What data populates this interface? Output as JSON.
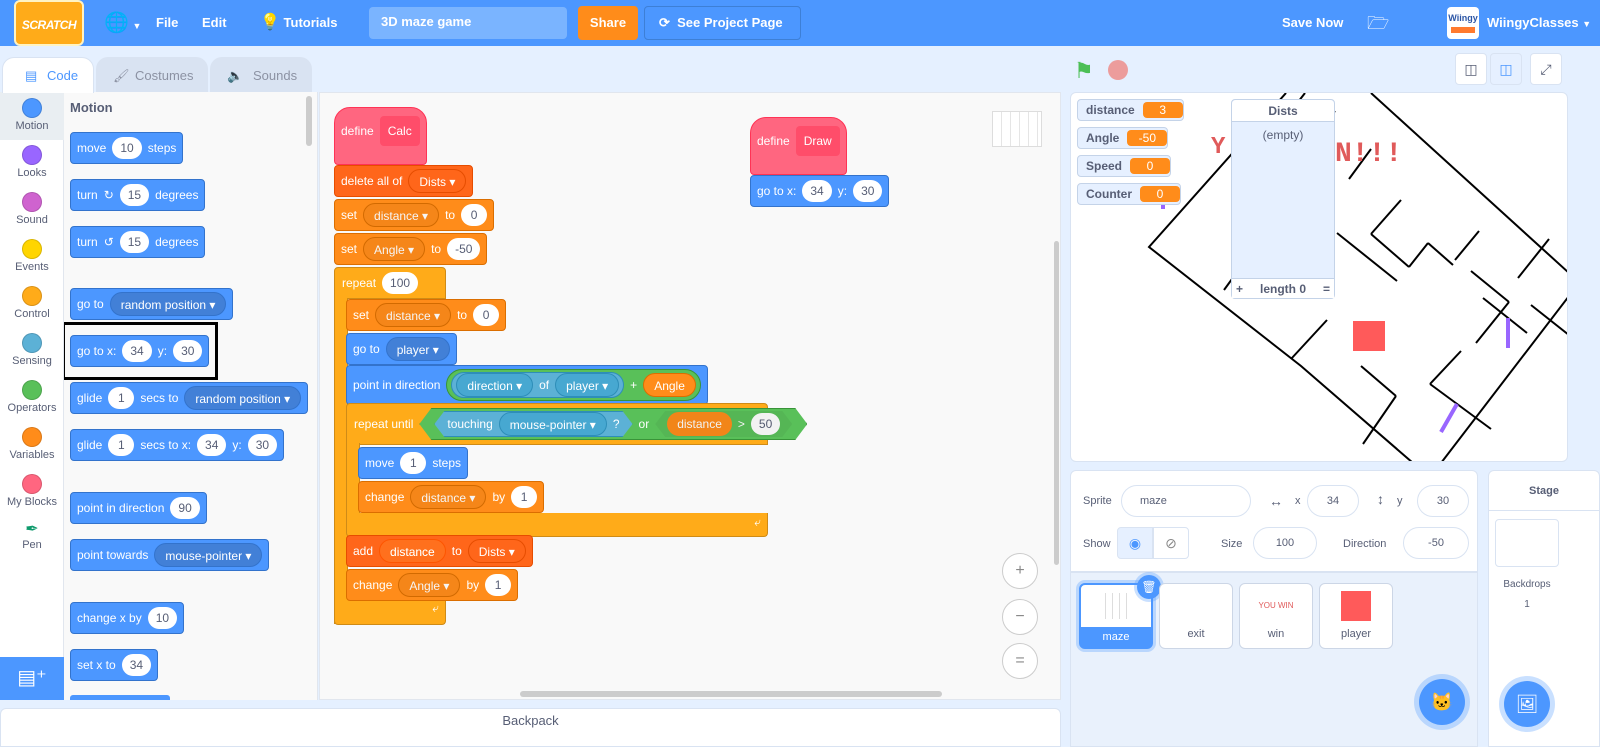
{
  "menubar": {
    "logo": "SCRATCH",
    "file": "File",
    "edit": "Edit",
    "tutorials": "Tutorials",
    "project_title": "3D maze game",
    "share": "Share",
    "see_project_page": "See Project Page",
    "save_now": "Save Now",
    "username": "WiingyClasses",
    "avatar_text": "Wiingy"
  },
  "tabs": [
    {
      "label": "Code",
      "active": true
    },
    {
      "label": "Costumes",
      "active": false
    },
    {
      "label": "Sounds",
      "active": false
    }
  ],
  "categories": [
    {
      "label": "Motion",
      "color": "#4c97ff"
    },
    {
      "label": "Looks",
      "color": "#9966ff"
    },
    {
      "label": "Sound",
      "color": "#cf63cf"
    },
    {
      "label": "Events",
      "color": "#ffd500"
    },
    {
      "label": "Control",
      "color": "#ffab19"
    },
    {
      "label": "Sensing",
      "color": "#5cb1d6"
    },
    {
      "label": "Operators",
      "color": "#59c059"
    },
    {
      "label": "Variables",
      "color": "#ff8c1a"
    },
    {
      "label": "My Blocks",
      "color": "#ff6680"
    },
    {
      "label": "Pen",
      "color": ""
    }
  ],
  "palette": {
    "heading": "Motion",
    "blocks": {
      "move": {
        "t1": "move",
        "v": "10",
        "t2": "steps"
      },
      "turn_right": {
        "t1": "turn",
        "v": "15",
        "t2": "degrees"
      },
      "turn_left": {
        "t1": "turn",
        "v": "15",
        "t2": "degrees"
      },
      "goto": {
        "t1": "go to",
        "dd": "random position"
      },
      "gotoxy": {
        "t1": "go to x:",
        "x": "34",
        "t2": "y:",
        "y": "30"
      },
      "glide_to": {
        "t1": "glide",
        "v": "1",
        "t2": "secs to",
        "dd": "random position"
      },
      "glide_xy": {
        "t1": "glide",
        "v": "1",
        "t2": "secs to x:",
        "x": "34",
        "t3": "y:",
        "y": "30"
      },
      "point_dir": {
        "t1": "point in direction",
        "v": "90"
      },
      "point_towards": {
        "t1": "point towards",
        "dd": "mouse-pointer"
      },
      "change_x": {
        "t1": "change x by",
        "v": "10"
      },
      "set_x": {
        "t1": "set x to",
        "v": "34"
      }
    }
  },
  "script_calc": {
    "define": "define",
    "name": "Calc",
    "delete_all": {
      "t1": "delete all of",
      "dd": "Dists"
    },
    "set1": {
      "t1": "set",
      "dd": "distance",
      "t2": "to",
      "v": "0"
    },
    "set2": {
      "t1": "set",
      "dd": "Angle",
      "t2": "to",
      "v": "-50"
    },
    "repeat": {
      "t1": "repeat",
      "v": "100"
    },
    "set3": {
      "t1": "set",
      "dd": "distance",
      "t2": "to",
      "v": "0"
    },
    "goto": {
      "t1": "go to",
      "dd": "player"
    },
    "point": {
      "t1": "point in direction",
      "dd1": "direction",
      "of": "of",
      "dd2": "player",
      "plus": "+",
      "var": "Angle"
    },
    "repeat_until": {
      "t1": "repeat until",
      "touching": "touching",
      "dd": "mouse-pointer",
      "q": "?",
      "or": "or",
      "var": "distance",
      "gt": ">",
      "v": "50"
    },
    "move": {
      "t1": "move",
      "v": "1",
      "t2": "steps"
    },
    "change1": {
      "t1": "change",
      "dd": "distance",
      "t2": "by",
      "v": "1"
    },
    "add": {
      "t1": "add",
      "var": "distance",
      "t2": "to",
      "dd": "Dists"
    },
    "change2": {
      "t1": "change",
      "dd": "Angle",
      "t2": "by",
      "v": "1"
    }
  },
  "script_draw": {
    "define": "define",
    "name": "Draw",
    "gotoxy": {
      "t1": "go to x:",
      "x": "34",
      "t2": "y:",
      "y": "30"
    }
  },
  "zoom": {
    "in": "+",
    "out": "−",
    "reset": "="
  },
  "stage": {
    "monitors": [
      {
        "name": "distance",
        "value": "3"
      },
      {
        "name": "Angle",
        "value": "-50"
      },
      {
        "name": "Speed",
        "value": "0"
      },
      {
        "name": "Counter",
        "value": "0"
      }
    ],
    "list": {
      "title": "Dists",
      "empty": "(empty)",
      "add": "+",
      "length": "length 0",
      "resize": "="
    }
  },
  "sprite_info": {
    "sprite_label": "Sprite",
    "sprite_name": "maze",
    "x_label": "x",
    "x": "34",
    "y_label": "y",
    "y": "30",
    "show_label": "Show",
    "size_label": "Size",
    "size": "100",
    "direction_label": "Direction",
    "direction": "-50"
  },
  "sprites": [
    {
      "name": "maze",
      "selected": true
    },
    {
      "name": "exit",
      "selected": false
    },
    {
      "name": "win",
      "selected": false,
      "thumb_text": "YOU WIN"
    },
    {
      "name": "player",
      "selected": false
    }
  ],
  "stage_panel": {
    "title": "Stage",
    "backdrops_label": "Backdrops",
    "backdrops_count": "1"
  },
  "backpack": "Backpack"
}
